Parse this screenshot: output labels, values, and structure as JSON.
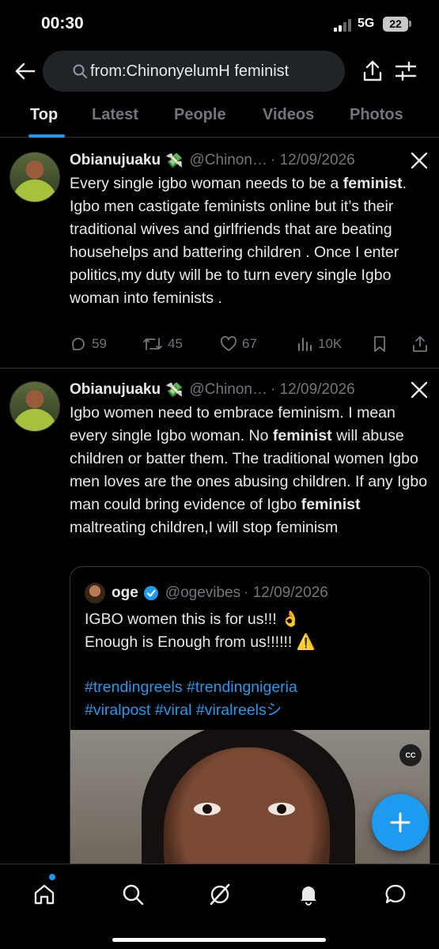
{
  "status_bar": {
    "time": "00:30",
    "network": "5G",
    "battery": "22"
  },
  "search": {
    "query": "from:ChinonyelumH feminist"
  },
  "tabs": [
    {
      "label": "Top",
      "active": true
    },
    {
      "label": "Latest"
    },
    {
      "label": "People"
    },
    {
      "label": "Videos"
    },
    {
      "label": "Photos"
    }
  ],
  "posts": [
    {
      "name": "Obianujuaku",
      "emoji": "💸",
      "handle": "@Chinon…",
      "date": "· 12/09/2026",
      "text_html": "Every single igbo woman needs to be a <b>feminist</b>. Igbo men castigate feminists online but it’s their traditional wives and girlfriends that are beating househelps and battering children . Once I enter politics,my duty will be to turn every single Igbo woman into feminists .",
      "replies": "59",
      "reposts": "45",
      "likes": "67",
      "views": "10K"
    },
    {
      "name": "Obianujuaku",
      "emoji": "💸",
      "handle": "@Chinon…",
      "date": "· 12/09/2026",
      "text_html": "Igbo women need to embrace feminism. I mean every single Igbo woman. No <b>feminist</b> will abuse children or batter them. The traditional women Igbo men loves are the ones abusing children. If any Igbo man could bring evidence of Igbo <b>feminist</b> maltreating children,I will stop feminism",
      "quote": {
        "name": "oge",
        "handle": "@ogevibes",
        "date": "· 12/09/2026",
        "line1": "IGBO women this is for us!!! 👌",
        "line2": "Enough is Enough from us!!!!!! ⚠️",
        "hashtags_line1": "#trendingreels #trendingnigeria",
        "hashtags_line2": "#viralpost #viral #viralreelsシ",
        "cc_label": "CC"
      }
    }
  ],
  "colors": {
    "accent": "#1d9bf0",
    "background": "#000000",
    "text": "#e7e9ea",
    "muted": "#71767b",
    "divider": "#2f3336"
  },
  "icons": [
    "back-arrow-icon",
    "search-icon",
    "share-icon",
    "filter-icon",
    "x-logo-icon",
    "reply-icon",
    "repost-icon",
    "like-icon",
    "views-icon",
    "bookmark-icon",
    "verified-icon",
    "plus-icon",
    "home-icon",
    "explore-icon",
    "grok-icon",
    "notifications-icon",
    "messages-icon"
  ]
}
